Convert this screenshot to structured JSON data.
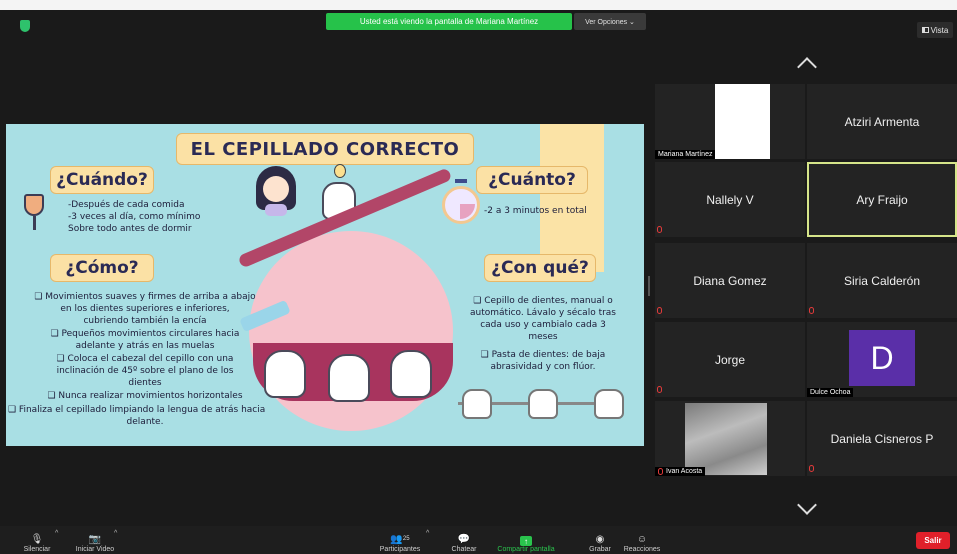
{
  "banner": {
    "viewing": "Usted está viendo la pantalla de Mariana Martínez",
    "view_options": "Ver Opciones ⌄",
    "vista": "Vista"
  },
  "slide": {
    "title": "EL CEPILLADO CORRECTO",
    "cuando": {
      "heading": "¿Cuándo?",
      "lines": [
        "-Después de cada comida",
        "-3 veces al día, como mínimo",
        "Sobre todo antes de dormir"
      ]
    },
    "cuanto": {
      "heading": "¿Cuánto?",
      "text": "-2 a 3 minutos en total"
    },
    "como": {
      "heading": "¿Cómo?",
      "lines": [
        "❑ Movimientos suaves y firmes de arriba a abajo",
        "en los dientes superiores e inferiores,",
        "cubriendo también la encía",
        "❑ Pequeños movimientos circulares hacia",
        "adelante y atrás en las muelas",
        "❑ Coloca el cabezal del cepillo con una",
        "inclinación de 45º sobre el plano de los",
        "dientes",
        "❑ Nunca realizar movimientos horizontales",
        "❑ Finaliza el cepillado limpiando la lengua de atrás hacia",
        "delante."
      ]
    },
    "con_que": {
      "heading": "¿Con qué?",
      "lines": [
        "❑ Cepillo de dientes, manual o",
        "automático. Lávalo y sécalo tras",
        "cada uso y cambialo cada 3",
        "meses",
        "❑ Pasta de dientes: de baja",
        "abrasividad y con flúor."
      ]
    }
  },
  "participants": [
    {
      "name": "Mariana Martínez",
      "label_style": "tag",
      "muted": false
    },
    {
      "name": "Atziri Armenta",
      "label_style": "center",
      "muted": false
    },
    {
      "name": "Nallely V",
      "label_style": "center",
      "muted": true
    },
    {
      "name": "Ary Fraijo",
      "label_style": "center",
      "muted": false,
      "active": true
    },
    {
      "name": "Diana Gomez",
      "label_style": "center",
      "muted": true
    },
    {
      "name": "Siria Calderón",
      "label_style": "center",
      "muted": true
    },
    {
      "name": "Jorge",
      "label_style": "center",
      "muted": true
    },
    {
      "name": "Dulce Ochoa",
      "label_style": "tag",
      "muted": false,
      "avatar_letter": "D"
    },
    {
      "name": "Ivan Acosta",
      "label_style": "tag",
      "muted": true
    },
    {
      "name": "Daniela Cisneros P",
      "label_style": "center",
      "muted": true
    }
  ],
  "toolbar": {
    "mute": "Silenciar",
    "video": "Iniciar Video",
    "participants": "Participantes",
    "participants_count": "25",
    "chat": "Chatear",
    "share": "Compartir pantalla",
    "record": "Grabar",
    "reactions": "Reacciones",
    "leave": "Salir"
  },
  "colors": {
    "slide_bg": "#a9dfe4",
    "accent_box": "#fbe1a5",
    "share_green": "#26c24a",
    "leave_red": "#e0202a",
    "active_border": "#d6e58a"
  }
}
